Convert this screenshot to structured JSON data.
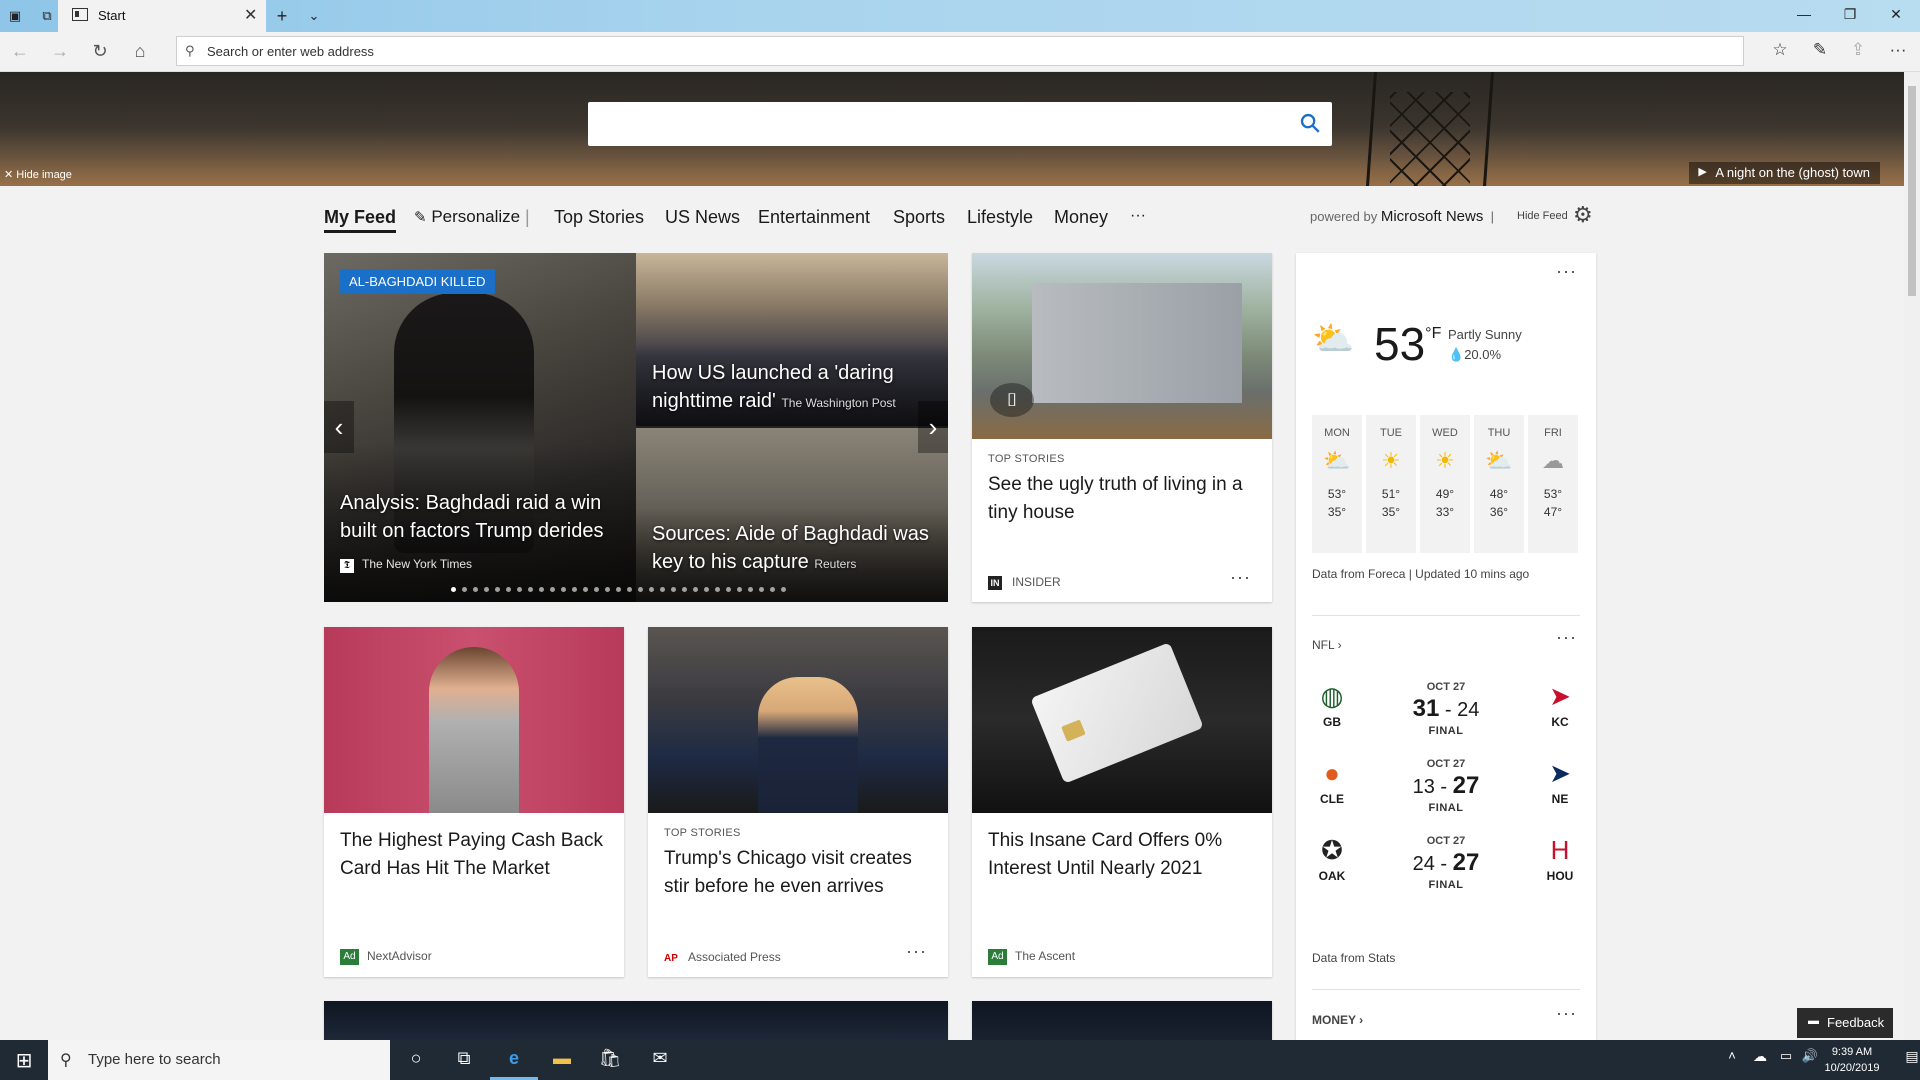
{
  "browser": {
    "tab_title": "Start",
    "address_placeholder": "Search or enter web address"
  },
  "hero": {
    "hide_image_label": "Hide image",
    "caption": "A night on the (ghost) town",
    "search_placeholder": ""
  },
  "feed_nav": {
    "items": [
      "My Feed",
      "Personalize",
      "Top Stories",
      "US News",
      "Entertainment",
      "Sports",
      "Lifestyle",
      "Money",
      "···"
    ],
    "powered_by": "powered by",
    "brand": "Microsoft News",
    "separator": "|",
    "hide_feed": "Hide Feed"
  },
  "carousel": {
    "tag": "AL-BAGHDADI KILLED",
    "main_title": "Analysis: Baghdadi raid a win built on factors Trump derides",
    "main_source": "The New York Times",
    "top_title": "How US launched a 'daring nighttime raid'",
    "top_source": "The Washington Post",
    "bottom_title": "Sources: Aide of Baghdadi was key to his capture",
    "bottom_source": "Reuters",
    "page_count": 31,
    "active_page": 0
  },
  "cards": [
    {
      "category": "TOP STORIES",
      "title": "See the ugly truth of living in a tiny house",
      "source": "INSIDER"
    },
    {
      "category": "",
      "title": "The Highest Paying Cash Back Card Has Hit The Market",
      "source": "NextAdvisor",
      "ad": "Ad"
    },
    {
      "category": "TOP STORIES",
      "title": "Trump's Chicago visit creates stir before he even arrives",
      "source": "Associated Press"
    },
    {
      "category": "",
      "title": "This Insane Card Offers 0% Interest Until Nearly 2021",
      "source": "The Ascent",
      "ad": "Ad"
    }
  ],
  "weather": {
    "temp": "53",
    "unit": "°F",
    "condition": "Partly Sunny",
    "precip": "20.0%",
    "forecast": [
      {
        "day": "MON",
        "hi": "53°",
        "lo": "35°",
        "icon": "partly-sunny-icon"
      },
      {
        "day": "TUE",
        "hi": "51°",
        "lo": "35°",
        "icon": "sunny-icon"
      },
      {
        "day": "WED",
        "hi": "49°",
        "lo": "33°",
        "icon": "sunny-icon"
      },
      {
        "day": "THU",
        "hi": "48°",
        "lo": "36°",
        "icon": "partly-sunny-icon"
      },
      {
        "day": "FRI",
        "hi": "53°",
        "lo": "47°",
        "icon": "cloudy-icon"
      }
    ],
    "footer": "Data from Foreca | Updated 10 mins ago"
  },
  "nfl": {
    "title": "NFL",
    "games": [
      {
        "date": "OCT 27",
        "score_a": "31",
        "score_b": "24",
        "status": "FINAL",
        "team_a": "GB",
        "team_b": "KC",
        "winner": "a"
      },
      {
        "date": "OCT 27",
        "score_a": "13",
        "score_b": "27",
        "status": "FINAL",
        "team_a": "CLE",
        "team_b": "NE",
        "winner": "b"
      },
      {
        "date": "OCT 27",
        "score_a": "24",
        "score_b": "27",
        "status": "FINAL",
        "team_a": "OAK",
        "team_b": "HOU",
        "winner": "b"
      }
    ],
    "footer": "Data from Stats"
  },
  "money": {
    "title": "MONEY"
  },
  "taskbar": {
    "search_placeholder": "Type here to search",
    "time": "9:39 AM",
    "date": "10/20/2019"
  },
  "feedback_label": "Feedback",
  "colors": {
    "accent": "#1a6fc9",
    "ad_badge": "#2d7d3a",
    "taskbar": "#1f2a35"
  }
}
